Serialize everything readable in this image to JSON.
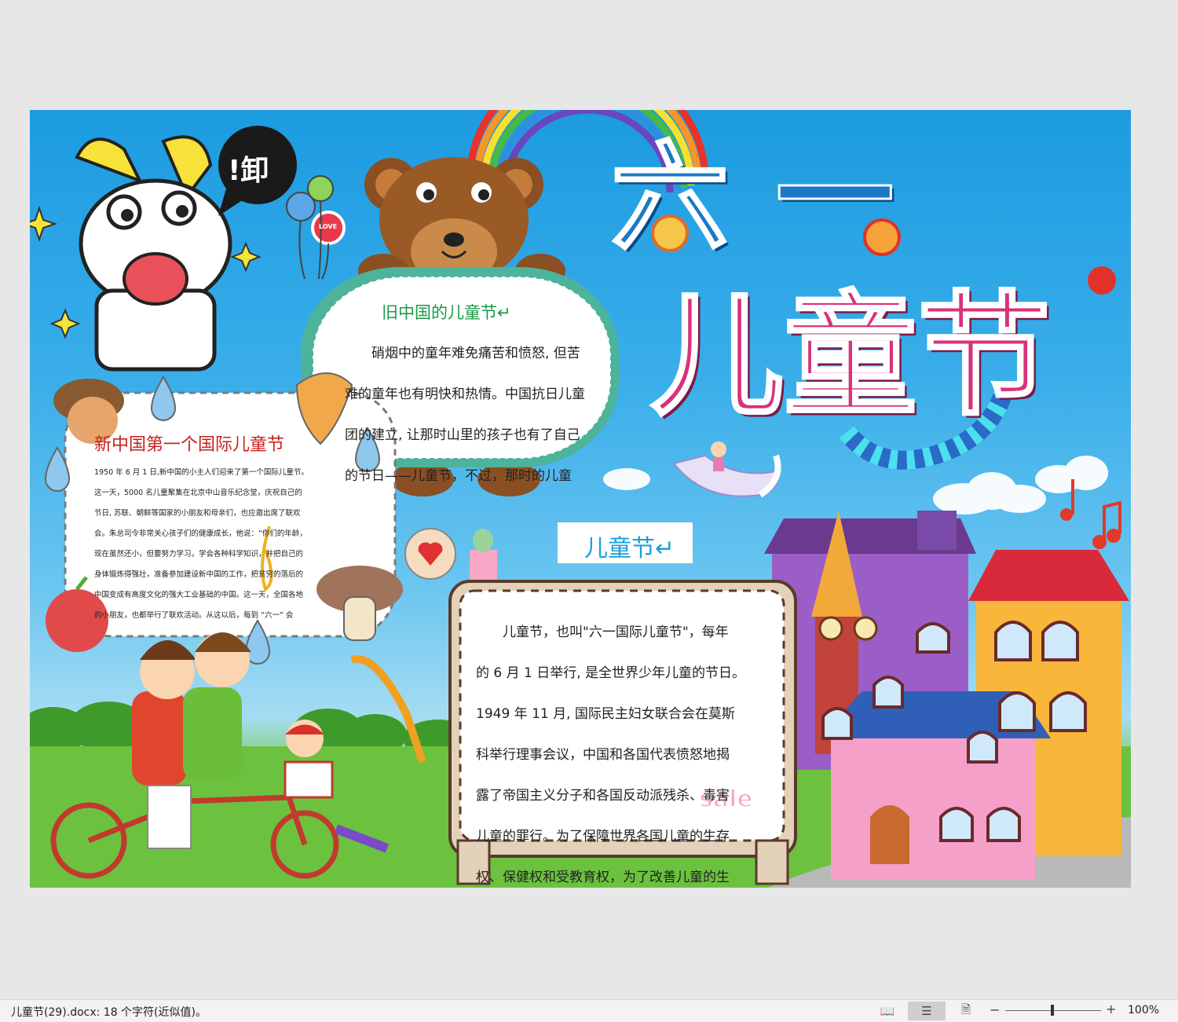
{
  "document": {
    "main_title_line1": "六一",
    "main_title_line2": "儿童节",
    "speech_bubble": "!卸",
    "balloon_label": "LOVE",
    "sale_tag": "sale",
    "section_old_china": {
      "heading": "旧中国的儿童节↵",
      "lines": [
        "硝烟中的童年难免痛苦和愤怒, 但苦",
        "难的童年也有明快和热情。中国抗日儿童",
        "团的建立, 让那时山里的孩子也有了自己",
        "的节日——儿童节，不过，那时的儿童"
      ]
    },
    "section_new_china": {
      "heading": "新中国第一个国际儿童节",
      "lines": [
        "1950 年 6 月 1 日,新中国的小主人们迎来了第一个国际儿童节。",
        "这一天，5000 名儿童聚集在北京中山音乐纪念堂，庆祝自己的",
        "节日, 苏联、朝鲜等国家的小朋友和母亲们，也应邀出席了联欢",
        "会。朱总司令非常关心孩子们的健康成长，他说：“你们的年龄，",
        "现在虽然还小，但要努力学习，学会各种科学知识，并把自己的",
        "身体锻炼得强壮，准备参加建设新中国的工作，把贫穷的落后的",
        "中国变成有高度文化的强大工业基础的中国。这一天，全国各地",
        "的小朋友，也都举行了联欢活动。从这以后，每到 “六一” 会"
      ]
    },
    "section_childrens_day": {
      "heading": "儿童节↵",
      "lines": [
        "儿童节，也叫\"六一国际儿童节\"，每年",
        "的 6 月 1 日举行, 是全世界少年儿童的节日。",
        "1949 年 11 月, 国际民主妇女联合会在莫斯",
        "科举行理事会议，中国和各国代表愤怒地揭",
        "露了帝国主义分子和各国反动派残杀、毒害",
        "儿童的罪行。为了保障世界各国儿童的生存",
        "权、保健权和受教育权，为了改善儿童的生"
      ]
    }
  },
  "statusbar": {
    "status_text": "儿童节(29).docx: 18 个字符(近似值)。",
    "read_mode_icon": "📖",
    "print_layout_icon": "☰",
    "web_layout_icon": "🗎",
    "zoom_minus": "−",
    "zoom_plus": "+",
    "zoom_label": "100%",
    "zoom_level_percent": 100
  },
  "colors": {
    "window_bg": "#e7e7e7",
    "sky": "#2aa6e6",
    "grass": "#5cb53a",
    "heading_green": "#1a9a4a",
    "heading_red": "#c8201e",
    "heading_blue": "#1aa0dc",
    "title_blue": "#1a78c8",
    "title_pink": "#d8327a"
  }
}
